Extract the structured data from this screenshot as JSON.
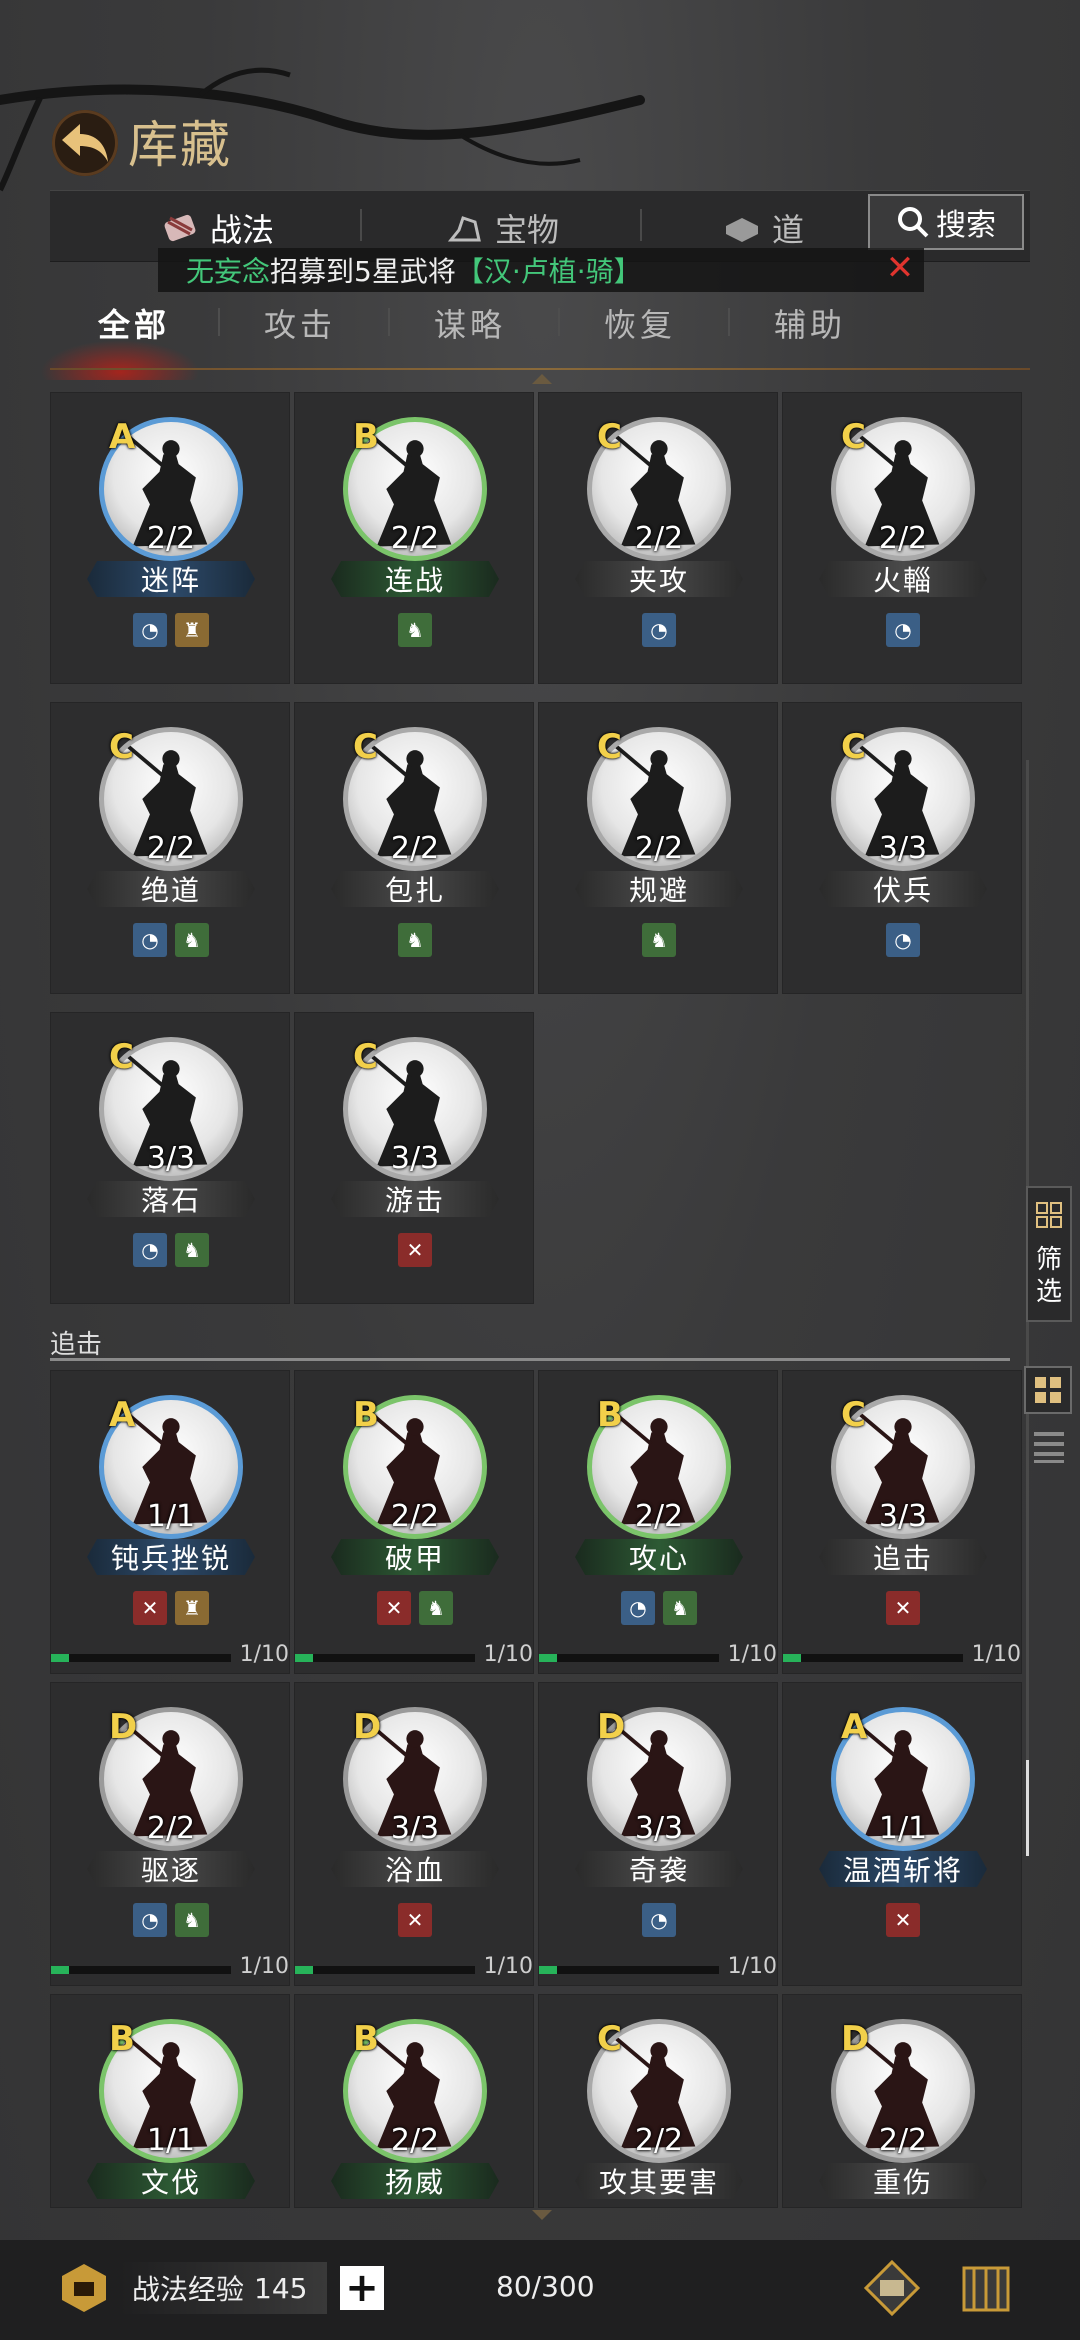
{
  "header": {
    "title": "库藏"
  },
  "category_tabs": [
    {
      "label": "战法",
      "icon": "scroll-icon",
      "active": true
    },
    {
      "label": "宝物",
      "icon": "treasure-icon",
      "active": false
    },
    {
      "label": "道",
      "icon": "item-icon",
      "active": false
    }
  ],
  "search": {
    "label": "搜索"
  },
  "notice": {
    "name": "无妄念",
    "text": "招募到5星武将",
    "hero": "【汉·卢植·骑】"
  },
  "filter_tabs": [
    {
      "label": "全部",
      "active": true
    },
    {
      "label": "攻击",
      "active": false
    },
    {
      "label": "谋略",
      "active": false
    },
    {
      "label": "恢复",
      "active": false
    },
    {
      "label": "辅助",
      "active": false
    }
  ],
  "section_title": "追击",
  "side": {
    "filter_label": "筛选"
  },
  "colors": {
    "grade_A": "#5b9bd6",
    "grade_B": "#7bc46a",
    "grade_C": "#a9a9a9",
    "grade_D": "#9a9a9a",
    "progress": "#27b35a",
    "notice_green": "#43c77a",
    "grade_text": "#f2d04a"
  },
  "cards_group1": [
    {
      "grade": "A",
      "count": "2/2",
      "name": "迷阵",
      "types": [
        "blue",
        "brown"
      ]
    },
    {
      "grade": "B",
      "count": "2/2",
      "name": "连战",
      "types": [
        "green"
      ]
    },
    {
      "grade": "C",
      "count": "2/2",
      "name": "夹攻",
      "types": [
        "blue"
      ]
    },
    {
      "grade": "C",
      "count": "2/2",
      "name": "火輜",
      "types": [
        "blue"
      ]
    },
    {
      "grade": "C",
      "count": "2/2",
      "name": "绝道",
      "types": [
        "blue",
        "green"
      ]
    },
    {
      "grade": "C",
      "count": "2/2",
      "name": "包扎",
      "types": [
        "green"
      ]
    },
    {
      "grade": "C",
      "count": "2/2",
      "name": "规避",
      "types": [
        "green"
      ]
    },
    {
      "grade": "C",
      "count": "3/3",
      "name": "伏兵",
      "types": [
        "blue"
      ]
    },
    {
      "grade": "C",
      "count": "3/3",
      "name": "落石",
      "types": [
        "blue",
        "green"
      ]
    },
    {
      "grade": "C",
      "count": "3/3",
      "name": "游击",
      "types": [
        "red"
      ]
    }
  ],
  "cards_group2": [
    {
      "grade": "A",
      "count": "1/1",
      "name": "钝兵挫锐",
      "types": [
        "red",
        "brown"
      ],
      "progress": "1/10",
      "fill": 0.1
    },
    {
      "grade": "B",
      "count": "2/2",
      "name": "破甲",
      "types": [
        "red",
        "green"
      ],
      "progress": "1/10",
      "fill": 0.1
    },
    {
      "grade": "B",
      "count": "2/2",
      "name": "攻心",
      "types": [
        "blue",
        "green"
      ],
      "progress": "1/10",
      "fill": 0.1
    },
    {
      "grade": "C",
      "count": "3/3",
      "name": "追击",
      "types": [
        "red"
      ],
      "progress": "1/10",
      "fill": 0.1
    },
    {
      "grade": "D",
      "count": "2/2",
      "name": "驱逐",
      "types": [
        "blue",
        "green"
      ],
      "progress": "1/10",
      "fill": 0.1
    },
    {
      "grade": "D",
      "count": "3/3",
      "name": "浴血",
      "types": [
        "red"
      ],
      "progress": "1/10",
      "fill": 0.1
    },
    {
      "grade": "D",
      "count": "3/3",
      "name": "奇袭",
      "types": [
        "blue"
      ],
      "progress": "1/10",
      "fill": 0.1
    },
    {
      "grade": "A",
      "count": "1/1",
      "name": "温酒斩将",
      "types": [
        "red"
      ],
      "progress": "",
      "fill": 0
    },
    {
      "grade": "B",
      "count": "1/1",
      "name": "文伐",
      "types": [],
      "progress": "",
      "fill": 0
    },
    {
      "grade": "B",
      "count": "2/2",
      "name": "扬威",
      "types": [],
      "progress": "",
      "fill": 0
    },
    {
      "grade": "C",
      "count": "2/2",
      "name": "攻其要害",
      "types": [],
      "progress": "",
      "fill": 0
    },
    {
      "grade": "D",
      "count": "2/2",
      "name": "重伤",
      "types": [],
      "progress": "",
      "fill": 0
    }
  ],
  "footer": {
    "exp_label": "战法经验",
    "exp_value": "145",
    "plus": "+",
    "capacity": "80/300"
  }
}
